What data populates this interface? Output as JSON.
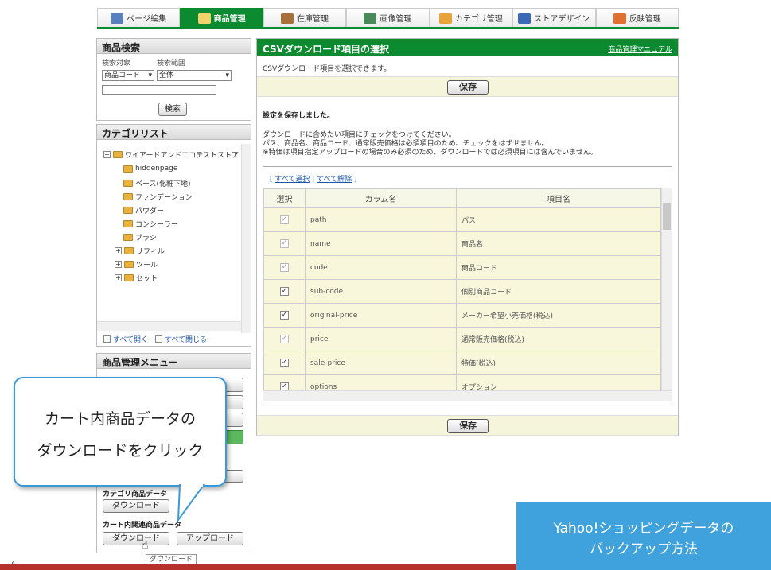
{
  "nav": {
    "tabs": [
      {
        "label": "ページ編集",
        "icon": "page-edit-icon",
        "active": false
      },
      {
        "label": "商品管理",
        "icon": "product-icon",
        "active": true
      },
      {
        "label": "在庫管理",
        "icon": "inventory-icon",
        "active": false
      },
      {
        "label": "画像管理",
        "icon": "image-icon",
        "active": false
      },
      {
        "label": "カテゴリ管理",
        "icon": "category-icon",
        "active": false
      },
      {
        "label": "ストアデザイン",
        "icon": "store-design-icon",
        "active": false
      },
      {
        "label": "反映管理",
        "icon": "publish-icon",
        "active": false
      }
    ]
  },
  "search": {
    "title": "商品検索",
    "target_label": "検索対象",
    "range_label": "検索範囲",
    "target_value": "商品コード",
    "range_value": "全体",
    "button": "検索"
  },
  "category": {
    "title": "カテゴリリスト",
    "root": "ワイアードアンドエコテストストア",
    "items": [
      "hiddenpage",
      "ベース(化粧下地)",
      "ファンデーション",
      "パウダー",
      "コンシーラー",
      "ブラシ"
    ],
    "expandable": [
      "リフィル",
      "ツール",
      "セット"
    ],
    "open_all": "すべて開く",
    "close_all": "すべて閉じる"
  },
  "menu": {
    "title": "商品管理メニュー",
    "category_product_label": "カテゴリ商品データ",
    "category_download": "ダウンロード",
    "cart_label": "カート内関連商品データ",
    "cart_download": "ダウンロード",
    "cart_upload": "アップロード",
    "tooltip": "ダウンロード"
  },
  "main": {
    "title": "CSVダウンロード項目の選択",
    "manual_link": "商品管理マニュアル",
    "intro": "CSVダウンロード項目を選択できます。",
    "save": "保存",
    "saved_msg": "設定を保存しました。",
    "note1": "ダウンロードに含めたい項目にチェックをつけてください。",
    "note2": "パス、商品名、商品コード、通常販売価格は必須項目のため、チェックをはずせません。",
    "note3": "※特価は項目指定アップロードの場合のみ必須のため、ダウンロードでは必須項目には含んでいません。",
    "select_all": "すべて選択",
    "deselect_all": "すべて解除",
    "col_select": "選択",
    "col_column": "カラム名",
    "col_item": "項目名",
    "rows": [
      {
        "column": "path",
        "item": "パス",
        "disabled": true
      },
      {
        "column": "name",
        "item": "商品名",
        "disabled": true
      },
      {
        "column": "code",
        "item": "商品コード",
        "disabled": true
      },
      {
        "column": "sub-code",
        "item": "個別商品コード",
        "disabled": false
      },
      {
        "column": "original-price",
        "item": "メーカー希望小売価格(税込)",
        "disabled": false
      },
      {
        "column": "price",
        "item": "通常販売価格(税込)",
        "disabled": true
      },
      {
        "column": "sale-price",
        "item": "特価(税込)",
        "disabled": false
      },
      {
        "column": "options",
        "item": "オプション",
        "disabled": false
      }
    ]
  },
  "callout": {
    "line1": "カート内商品データの",
    "line2": "ダウンロードをクリック"
  },
  "overlay": {
    "line1": "Yahoo!ショッピングデータの",
    "line2": "バックアップ方法"
  }
}
